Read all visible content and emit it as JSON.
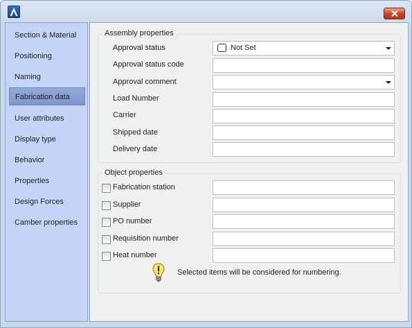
{
  "window": {
    "close_icon": "close-icon",
    "logo_icon": "app-logo-icon"
  },
  "sidebar": {
    "items": [
      {
        "label": "Section & Material"
      },
      {
        "label": "Positioning"
      },
      {
        "label": "Naming"
      },
      {
        "label": "Fabrication data",
        "active": true
      },
      {
        "label": "User attributes"
      },
      {
        "label": "Display type"
      },
      {
        "label": "Behavior"
      },
      {
        "label": "Properties"
      },
      {
        "label": "Design Forces"
      },
      {
        "label": "Camber properties"
      }
    ]
  },
  "assembly": {
    "legend": "Assembly properties",
    "approval_status": {
      "label": "Approval status",
      "value": "Not Set"
    },
    "approval_status_code": {
      "label": "Approval status code",
      "value": ""
    },
    "approval_comment": {
      "label": "Approval comment",
      "value": ""
    },
    "load_number": {
      "label": "Load Number",
      "value": ""
    },
    "carrier": {
      "label": "Carrier",
      "value": ""
    },
    "shipped_date": {
      "label": "Shipped date",
      "value": ""
    },
    "delivery_date": {
      "label": "Delivery date",
      "value": ""
    }
  },
  "object": {
    "legend": "Object properties",
    "fabrication_station": {
      "label": "Fabrication station",
      "checked": false,
      "value": ""
    },
    "supplier": {
      "label": "Supplier",
      "checked": false,
      "value": ""
    },
    "po_number": {
      "label": "PO number",
      "checked": false,
      "value": ""
    },
    "requisition_number": {
      "label": "Requisition number",
      "checked": false,
      "value": ""
    },
    "heat_number": {
      "label": "Heat number",
      "checked": false,
      "value": ""
    }
  },
  "info": {
    "icon": "lightbulb-icon",
    "text": "Selected items will be considered for numbering."
  }
}
